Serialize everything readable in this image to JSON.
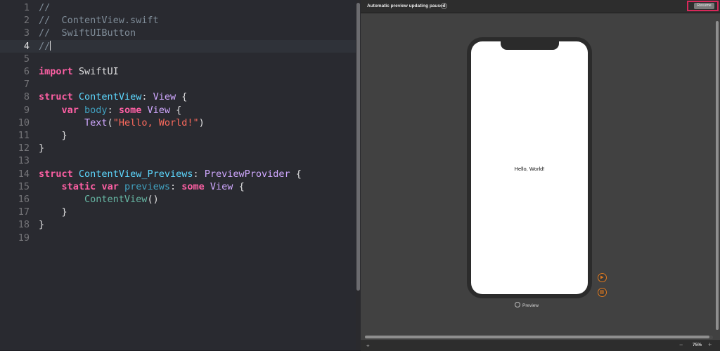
{
  "editor": {
    "lines": [
      {
        "num": "1",
        "tokens": [
          {
            "t": "//",
            "c": "comment"
          }
        ]
      },
      {
        "num": "2",
        "tokens": [
          {
            "t": "//  ContentView.swift",
            "c": "comment"
          }
        ]
      },
      {
        "num": "3",
        "tokens": [
          {
            "t": "//  SwiftUIButton",
            "c": "comment"
          }
        ]
      },
      {
        "num": "4",
        "current": true,
        "caret": true,
        "tokens": [
          {
            "t": "//",
            "c": "comment"
          }
        ]
      },
      {
        "num": "5",
        "tokens": []
      },
      {
        "num": "6",
        "tokens": [
          {
            "t": "import",
            "c": "keyword"
          },
          {
            "t": " SwiftUI",
            "c": "plain"
          }
        ]
      },
      {
        "num": "7",
        "tokens": []
      },
      {
        "num": "8",
        "tokens": [
          {
            "t": "struct",
            "c": "keyword"
          },
          {
            "t": " ",
            "c": "plain"
          },
          {
            "t": "ContentView",
            "c": "typedecl"
          },
          {
            "t": ": ",
            "c": "plain"
          },
          {
            "t": "View",
            "c": "type"
          },
          {
            "t": " {",
            "c": "plain"
          }
        ]
      },
      {
        "num": "9",
        "tokens": [
          {
            "t": "    ",
            "c": "plain"
          },
          {
            "t": "var",
            "c": "keyword"
          },
          {
            "t": " ",
            "c": "plain"
          },
          {
            "t": "body",
            "c": "prop"
          },
          {
            "t": ": ",
            "c": "plain"
          },
          {
            "t": "some",
            "c": "keyword"
          },
          {
            "t": " ",
            "c": "plain"
          },
          {
            "t": "View",
            "c": "type"
          },
          {
            "t": " {",
            "c": "plain"
          }
        ]
      },
      {
        "num": "10",
        "tokens": [
          {
            "t": "        ",
            "c": "plain"
          },
          {
            "t": "Text",
            "c": "type"
          },
          {
            "t": "(",
            "c": "plain"
          },
          {
            "t": "\"Hello, World!\"",
            "c": "string"
          },
          {
            "t": ")",
            "c": "plain"
          }
        ]
      },
      {
        "num": "11",
        "tokens": [
          {
            "t": "    }",
            "c": "plain"
          }
        ]
      },
      {
        "num": "12",
        "tokens": [
          {
            "t": "}",
            "c": "plain"
          }
        ]
      },
      {
        "num": "13",
        "tokens": []
      },
      {
        "num": "14",
        "tokens": [
          {
            "t": "struct",
            "c": "keyword"
          },
          {
            "t": " ",
            "c": "plain"
          },
          {
            "t": "ContentView_Previews",
            "c": "typedecl"
          },
          {
            "t": ": ",
            "c": "plain"
          },
          {
            "t": "PreviewProvider",
            "c": "type"
          },
          {
            "t": " {",
            "c": "plain"
          }
        ]
      },
      {
        "num": "15",
        "tokens": [
          {
            "t": "    ",
            "c": "plain"
          },
          {
            "t": "static",
            "c": "keyword"
          },
          {
            "t": " ",
            "c": "plain"
          },
          {
            "t": "var",
            "c": "keyword"
          },
          {
            "t": " ",
            "c": "plain"
          },
          {
            "t": "previews",
            "c": "prop"
          },
          {
            "t": ": ",
            "c": "plain"
          },
          {
            "t": "some",
            "c": "keyword"
          },
          {
            "t": " ",
            "c": "plain"
          },
          {
            "t": "View",
            "c": "type"
          },
          {
            "t": " {",
            "c": "plain"
          }
        ]
      },
      {
        "num": "16",
        "tokens": [
          {
            "t": "        ",
            "c": "plain"
          },
          {
            "t": "ContentView",
            "c": "call"
          },
          {
            "t": "()",
            "c": "plain"
          }
        ]
      },
      {
        "num": "17",
        "tokens": [
          {
            "t": "    }",
            "c": "plain"
          }
        ]
      },
      {
        "num": "18",
        "tokens": [
          {
            "t": "}",
            "c": "plain"
          }
        ]
      },
      {
        "num": "19",
        "tokens": []
      }
    ]
  },
  "canvas": {
    "status_text": "Automatic preview updating paused",
    "info_icon": "info-icon",
    "resume_label": "Resume",
    "resume_highlight_color": "#d8285a",
    "preview_text": "Hello, World!",
    "preview_label": "Preview",
    "zoom_level": "75%",
    "zoom_out_symbol": "−",
    "zoom_in_symbol": "+",
    "accent_color": "#e07a1f"
  }
}
